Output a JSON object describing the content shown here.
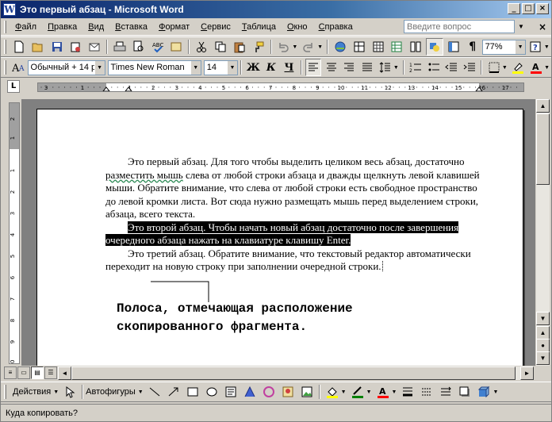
{
  "window": {
    "title": "Это первый абзац - Microsoft Word",
    "controls": {
      "minimize": "_",
      "maximize": "□",
      "close": "×"
    }
  },
  "menubar": {
    "items": [
      "Файл",
      "Правка",
      "Вид",
      "Вставка",
      "Формат",
      "Сервис",
      "Таблица",
      "Окно",
      "Справка"
    ],
    "help_placeholder": "Введите вопрос",
    "close": "×"
  },
  "standard_toolbar": {
    "zoom": "77%",
    "icons": [
      "new-icon",
      "open-icon",
      "save-icon",
      "permission-icon",
      "email-icon",
      "print-icon",
      "print-preview-icon",
      "spelling-icon",
      "research-icon",
      "cut-icon",
      "copy-icon",
      "paste-icon",
      "format-painter-icon",
      "undo-icon",
      "redo-icon",
      "hyperlink-icon",
      "tables-borders-icon",
      "insert-table-icon",
      "insert-excel-icon",
      "columns-icon",
      "drawing-icon",
      "document-map-icon",
      "show-hide-icon",
      "help-icon"
    ]
  },
  "formatting_toolbar": {
    "style": "Обычный + 14 р",
    "font": "Times New Roman",
    "size": "14",
    "bold": "Ж",
    "italic": "К",
    "underline": "Ч",
    "font_color": "#ff0000"
  },
  "ruler": {
    "labels": [
      "3",
      "1",
      "1",
      "2",
      "3",
      "4",
      "5",
      "6",
      "7",
      "8",
      "9",
      "10",
      "11",
      "12",
      "13",
      "14",
      "15",
      "16",
      "17"
    ]
  },
  "vertical_ruler": {
    "labels": [
      "2",
      "1",
      "1",
      "2",
      "3",
      "4",
      "5",
      "6",
      "7",
      "8",
      "9",
      "10"
    ]
  },
  "document": {
    "paragraph1": "Это первый абзац. Для того чтобы выделить целиком весь абзац, достаточно",
    "paragraph1_wavy": "разместить мышь",
    "paragraph1_rest": "слева от любой строки абзаца и дважды щелкнуть левой клавишей мыши. Обратите внимание, что слева от любой строки есть свободное пространство до левой кромки листа. Вот сюда нужно размещать мышь перед выделением строки, абзаца, всего текста.",
    "paragraph2_selected": "Это второй абзац. Чтобы начать новый абзац достаточно после завершения очередного абзаца нажать на клавиатуре клавишу Enter.",
    "paragraph3": "Это третий абзац. Обратите внимание, что текстовый редактор автоматически переходит на новую строку при заполнении очередной строки.",
    "callout": "Полоса, отмечающая расположение\nскопированного фрагмента."
  },
  "drawing_toolbar": {
    "actions": "Действия",
    "autoshapes": "Автофигуры",
    "line_color": "#008000",
    "fill_color": "#ffff00",
    "font_color": "#ff0000"
  },
  "status": {
    "text": "Куда копировать?"
  }
}
